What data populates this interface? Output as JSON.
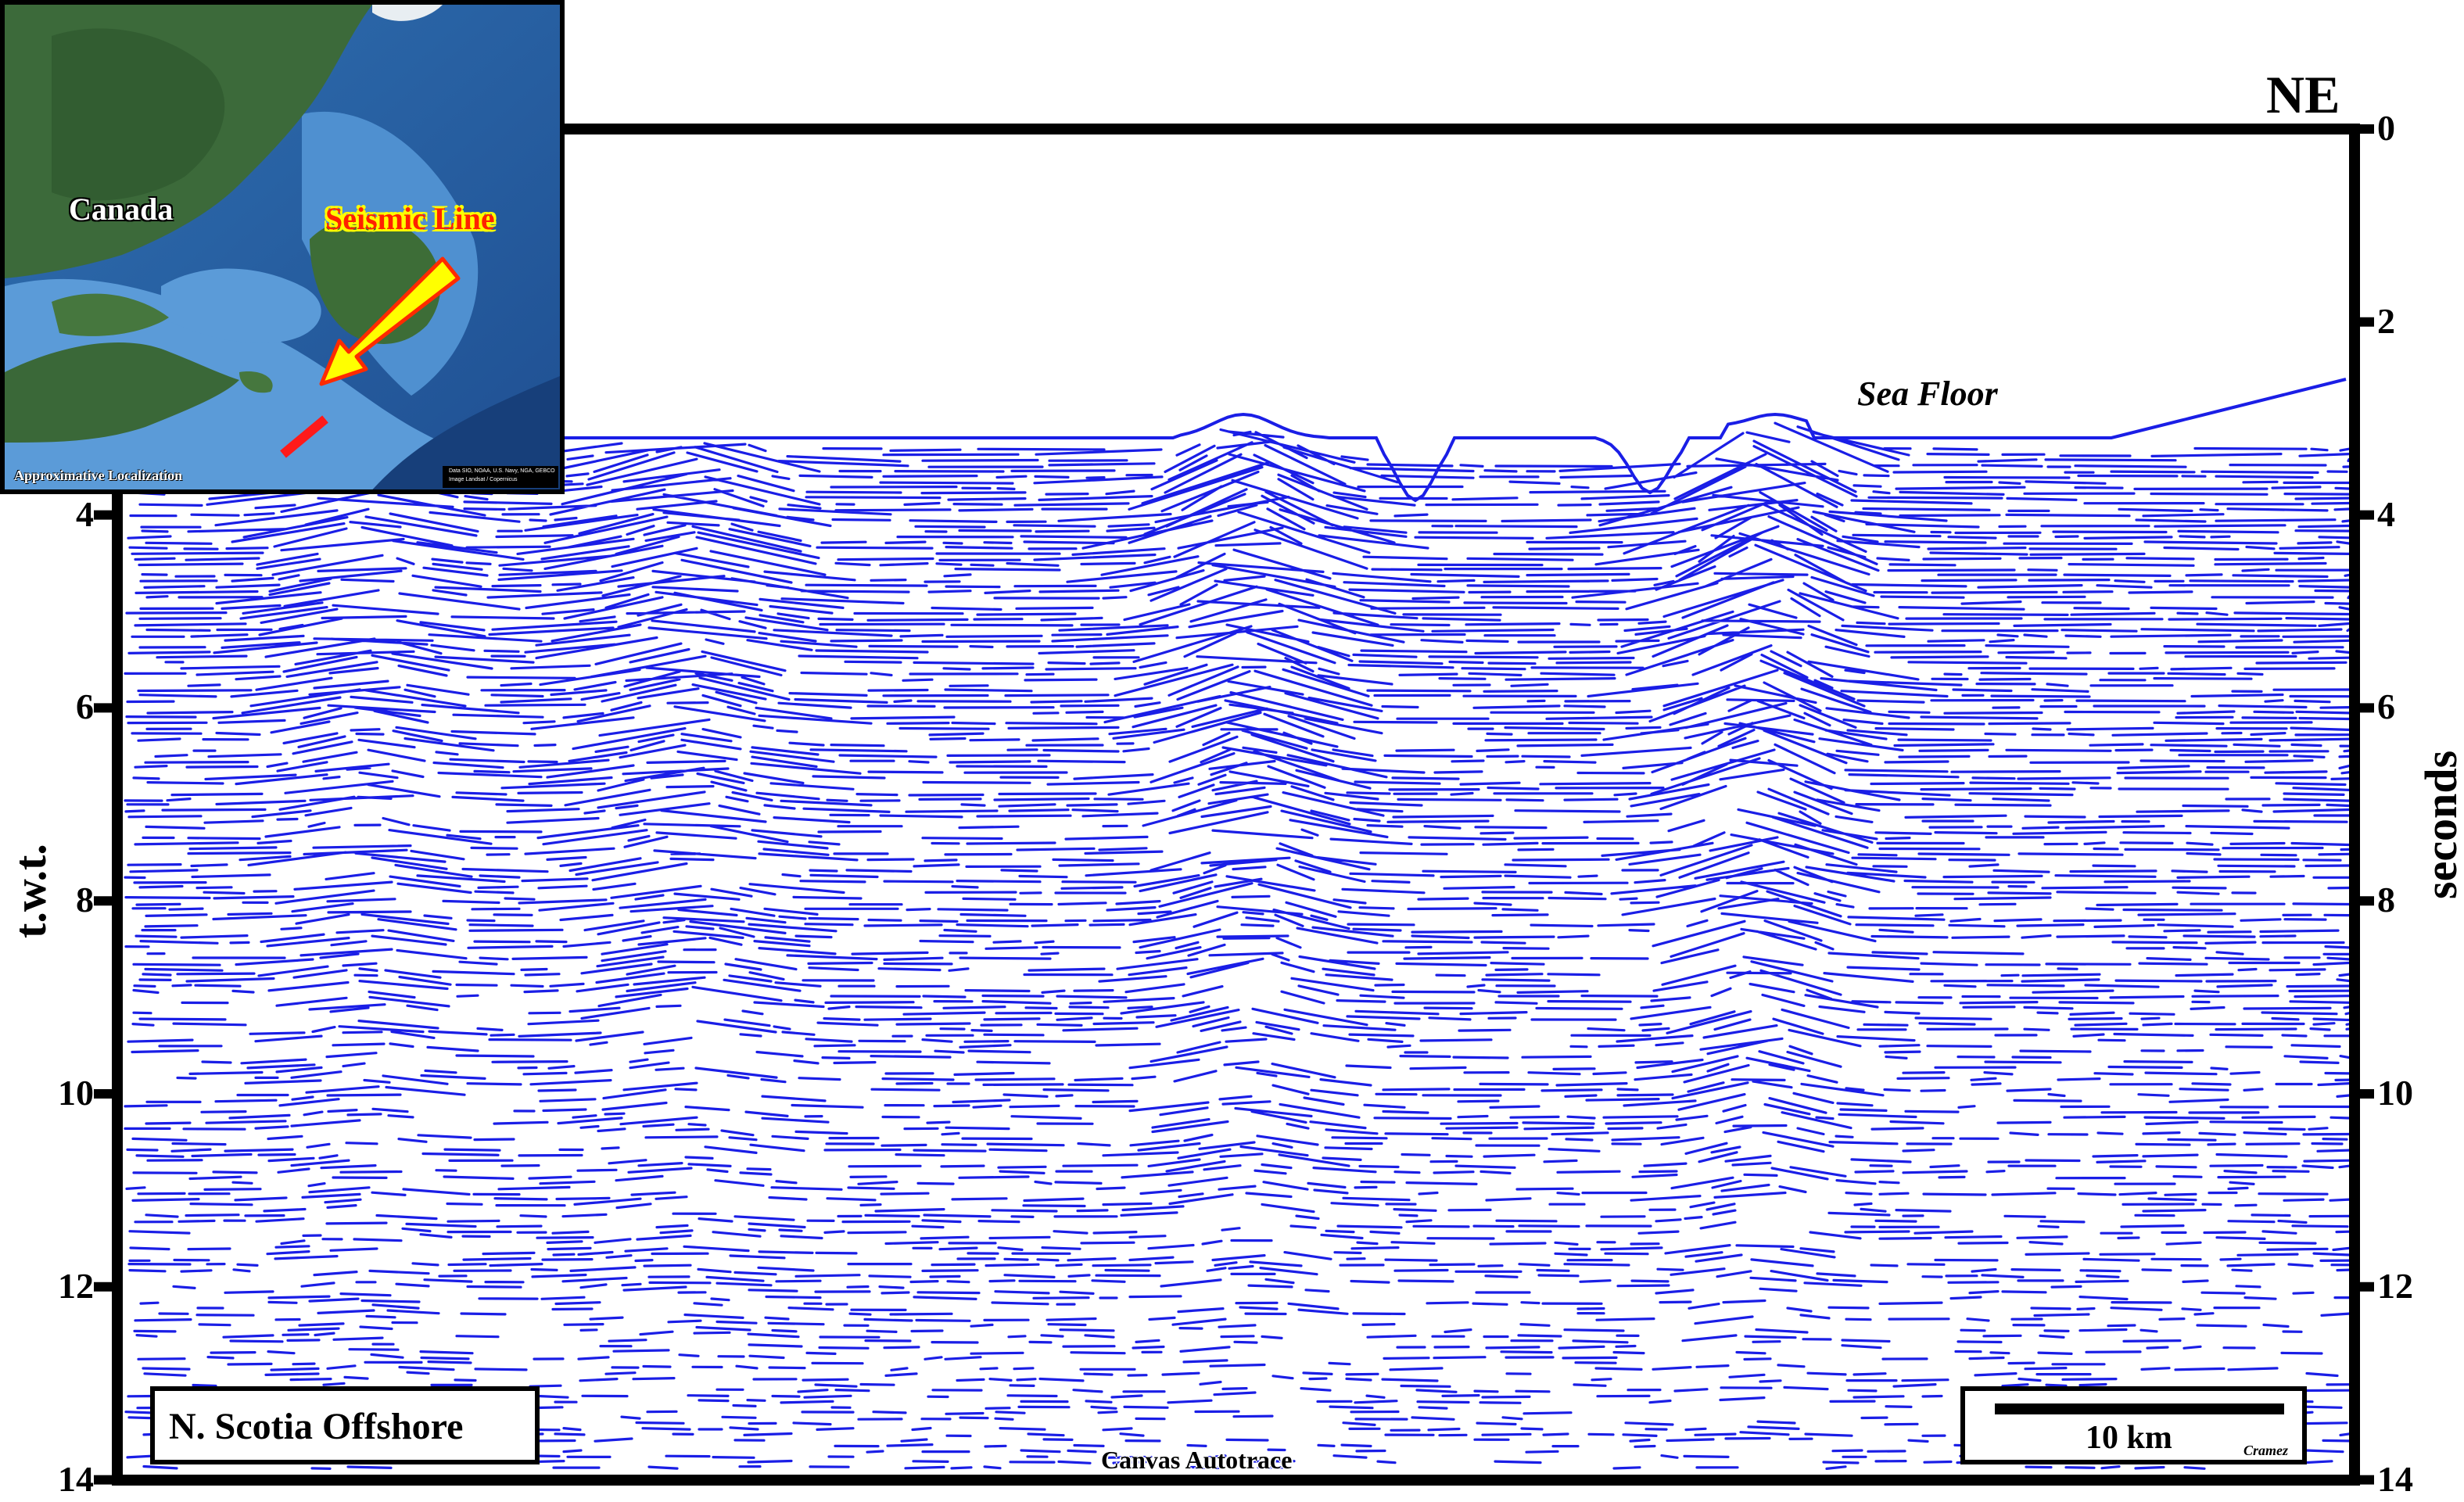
{
  "header": {
    "direction_label": "NE"
  },
  "axes": {
    "left_label": "t.w.t.",
    "right_label": "seconds",
    "left_ticks": [
      "4",
      "6",
      "8",
      "10",
      "12",
      "14"
    ],
    "right_ticks": [
      "0",
      "2",
      "4",
      "6",
      "8",
      "10",
      "12",
      "14"
    ],
    "range": [
      0,
      14
    ],
    "unit": "seconds"
  },
  "annotations": {
    "sea_floor": "Sea Floor",
    "location_box": "N. Scotia Offshore",
    "software_credit": "Canvas Autotrace",
    "scale_bar": "10 km",
    "author": "Cramez"
  },
  "inset_map": {
    "country": "Canada",
    "line_label": "Seismic Line",
    "footer": "Approximative Localization",
    "credit_line_1": "Data SIO, NOAA, U.S. Navy, NGA, GEBCO",
    "credit_line_2": "Image Landsat / Copernicus"
  },
  "colors": {
    "reflectors": "#1a1ee6",
    "frame": "#000000",
    "arrow_fill": "#ffff00",
    "arrow_outline": "#ff2a00",
    "line_marker": "#ff1a1a"
  }
}
